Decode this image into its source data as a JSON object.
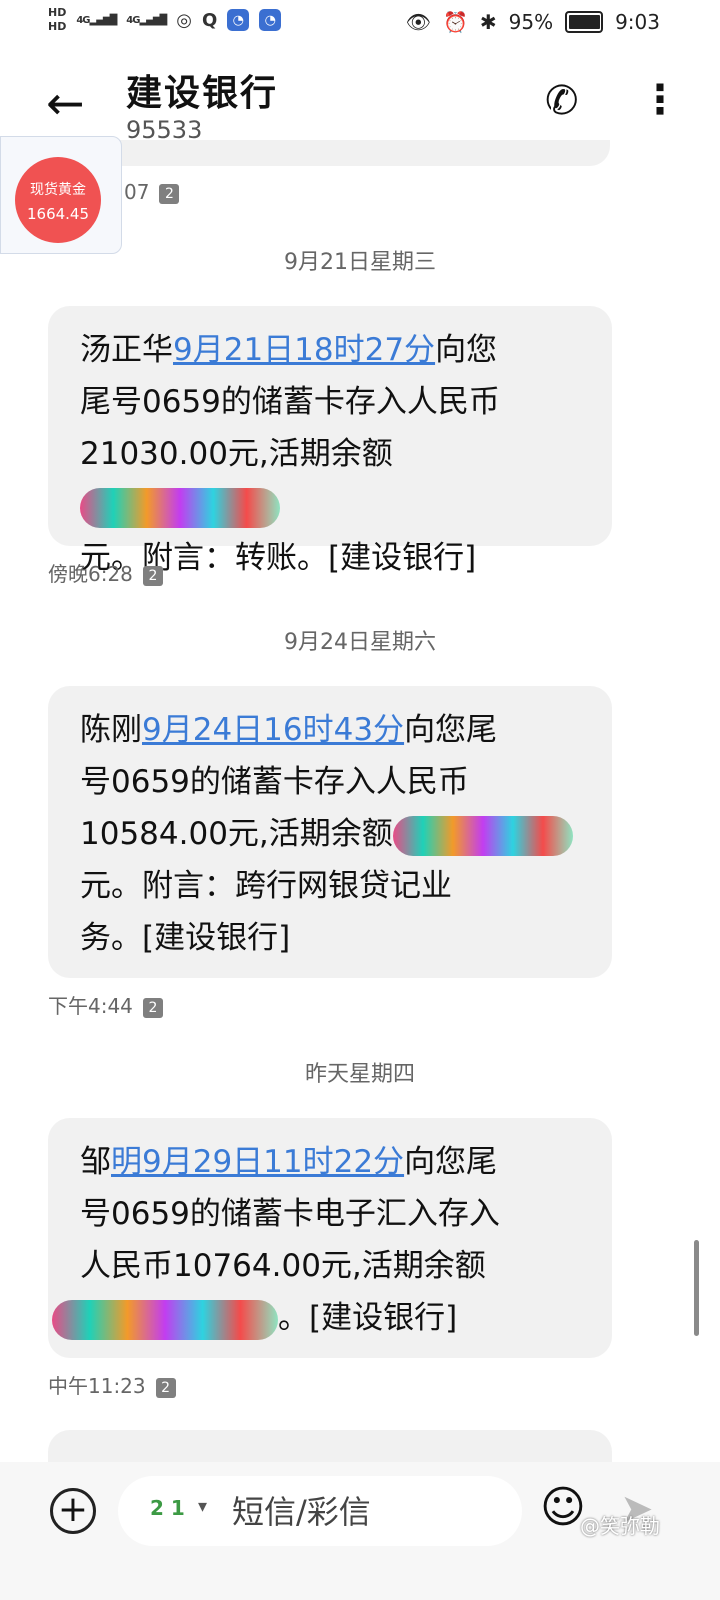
{
  "status_bar": {
    "hd1": "HD",
    "hd2": "HD",
    "signal1": "4G",
    "signal2": "4G",
    "battery_pct": "95%",
    "time": "9:03"
  },
  "header": {
    "contact_name": "建设银行",
    "contact_number": "95533"
  },
  "gold_widget": {
    "title": "现货黄金",
    "price": "1664.45"
  },
  "prev_time": "07",
  "sim_badge": "2",
  "date_separators": [
    "9月21日星期三",
    "9月24日星期六",
    "昨天星期四"
  ],
  "messages": [
    {
      "name": "汤正华",
      "date_link": "9月21日18时27分",
      "line1_rest": "向您",
      "line2": "尾号0659的储蓄卡存入人民币",
      "line3": "21030.00元,活期余额",
      "line4": "元。附言：转账。[建设银行]",
      "time": "傍晚6:28"
    },
    {
      "name": "陈刚",
      "date_link": "9月24日16时43分",
      "line1_rest": "向您尾",
      "line2": "号0659的储蓄卡存入人民币",
      "line3": "10584.00元,活期余额",
      "line4": "元。附言：跨行网银贷记业",
      "line5": "务。[建设银行]",
      "time": "下午4:44"
    },
    {
      "name": "邹",
      "date_link": "明9月29日11时22分",
      "line1_rest": "向您尾",
      "line2": "号0659的储蓄卡电子汇入存入",
      "line3": "人民币10764.00元,活期余额",
      "line4": "。[建设银行]",
      "time": "中午11:23"
    }
  ],
  "composer": {
    "sim_label": "2 1",
    "placeholder": "短信/彩信"
  },
  "watermark": "@笑弥勒"
}
